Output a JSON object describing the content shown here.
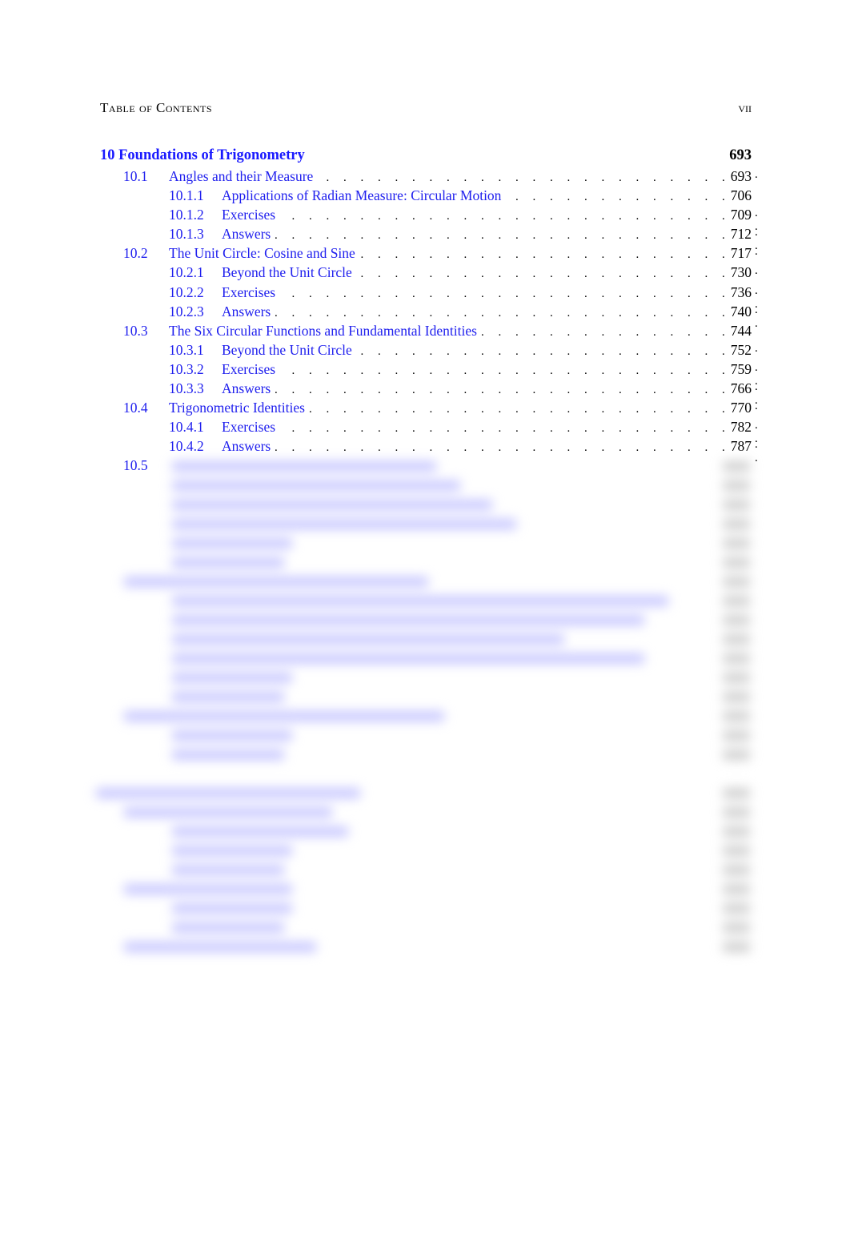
{
  "running_head": {
    "title": "Table of Contents",
    "folio": "vii"
  },
  "chapter": {
    "label": "10 Foundations of Trigonometry",
    "page": "693"
  },
  "entries": [
    {
      "level": "section",
      "number": "10.1",
      "title": "Angles and their Measure",
      "page": "693",
      "trail": "."
    },
    {
      "level": "subsection",
      "number": "10.1.1",
      "title": "Applications of Radian Measure: Circular Motion",
      "page": "706",
      "trail": ""
    },
    {
      "level": "subsection",
      "number": "10.1.2",
      "title": "Exercises",
      "page": "709",
      "trail": ". ."
    },
    {
      "level": "subsection",
      "number": "10.1.3",
      "title": "Answers",
      "page": "712",
      "trail": ". ."
    },
    {
      "level": "section",
      "number": "10.2",
      "title": "The Unit Circle: Cosine and Sine",
      "page": "717",
      "trail": "."
    },
    {
      "level": "subsection",
      "number": "10.2.1",
      "title": "Beyond the Unit Circle",
      "page": "730",
      "trail": "."
    },
    {
      "level": "subsection",
      "number": "10.2.2",
      "title": "Exercises",
      "page": "736",
      "trail": ". ."
    },
    {
      "level": "subsection",
      "number": "10.2.3",
      "title": "Answers",
      "page": "740",
      "trail": ". ."
    },
    {
      "level": "section",
      "number": "10.3",
      "title": "The Six Circular Functions and Fundamental Identities",
      "page": "744",
      "trail": ""
    },
    {
      "level": "subsection",
      "number": "10.3.1",
      "title": "Beyond the Unit Circle",
      "page": "752",
      "trail": "."
    },
    {
      "level": "subsection",
      "number": "10.3.2",
      "title": "Exercises",
      "page": "759",
      "trail": ". ."
    },
    {
      "level": "subsection",
      "number": "10.3.3",
      "title": "Answers",
      "page": "766",
      "trail": ". ."
    },
    {
      "level": "section",
      "number": "10.4",
      "title": "Trigonometric Identities",
      "page": "770",
      "trail": "."
    },
    {
      "level": "subsection",
      "number": "10.4.1",
      "title": "Exercises",
      "page": "782",
      "trail": ". ."
    },
    {
      "level": "subsection",
      "number": "10.4.2",
      "title": "Answers",
      "page": "787",
      "trail": ". ."
    }
  ],
  "partially_visible": {
    "number": "10.5"
  },
  "colors": {
    "link": "#2020ee",
    "chapter_link": "#1a1aff",
    "text": "#000000"
  }
}
